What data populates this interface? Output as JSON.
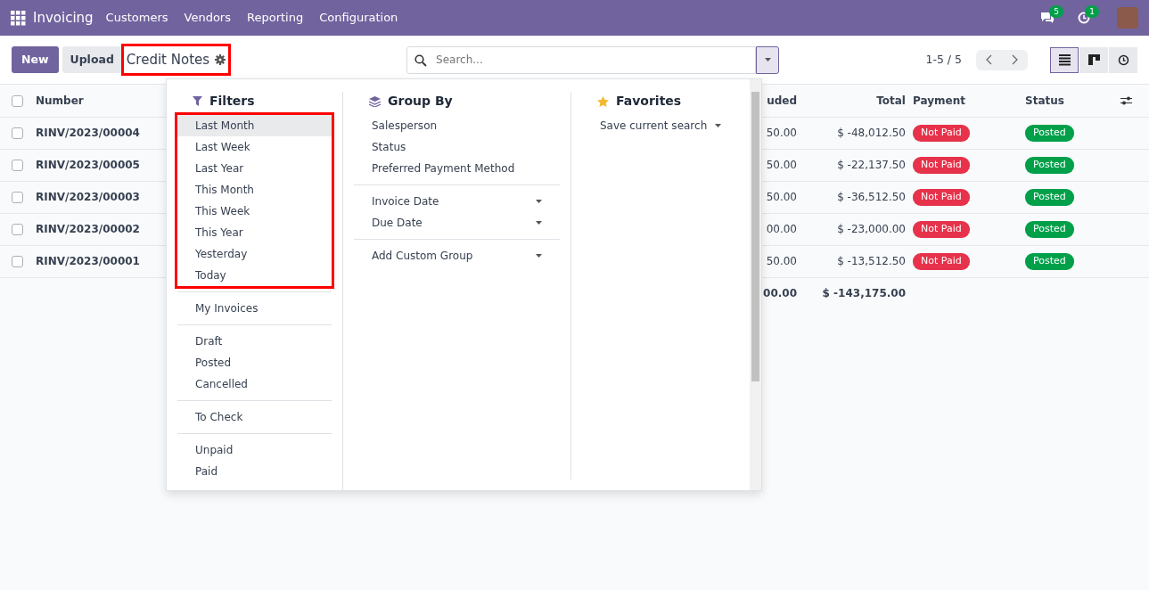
{
  "navbar": {
    "app": "Invoicing",
    "menus": [
      "Customers",
      "Vendors",
      "Reporting",
      "Configuration"
    ],
    "messages_count": "5",
    "activities_count": "1"
  },
  "control_panel": {
    "buttons": [
      "New",
      "Upload"
    ],
    "title": "Credit Notes",
    "title_annotated": true,
    "search": {
      "placeholder": "Search..."
    },
    "pager": "1-5 / 5",
    "views": [
      {
        "kind": "list",
        "selected": true
      },
      {
        "kind": "kanban",
        "selected": false
      },
      {
        "kind": "activity",
        "selected": false
      }
    ]
  },
  "table": {
    "select_all_checked": false,
    "columns": [
      "Number",
      "uded",
      "Total",
      "Payment",
      "Status"
    ],
    "rows": [
      {
        "number": "RINV/2023/00004",
        "column_2": "50.00",
        "total": "$ -48,012.50",
        "payment": "Not Paid",
        "status": "Posted",
        "checked": false
      },
      {
        "number": "RINV/2023/00005",
        "column_2": "50.00",
        "total": "$ -22,137.50",
        "payment": "Not Paid",
        "status": "Posted",
        "checked": false
      },
      {
        "number": "RINV/2023/00003",
        "column_2": "50.00",
        "total": "$ -36,512.50",
        "payment": "Not Paid",
        "status": "Posted",
        "checked": false
      },
      {
        "number": "RINV/2023/00002",
        "column_2": "00.00",
        "total": "$ -23,000.00",
        "payment": "Not Paid",
        "status": "Posted",
        "checked": false
      },
      {
        "number": "RINV/2023/00001",
        "column_2": "50.00",
        "total": "$ -13,512.50",
        "payment": "Not Paid",
        "status": "Posted",
        "checked": false
      }
    ],
    "totals": {
      "column_2": "00.00",
      "total": "$ -143,175.00"
    }
  },
  "dropdown": {
    "filters": {
      "title": "Filters",
      "groups": [
        {
          "annotated": true,
          "items": [
            {
              "label": "Last Month",
              "highlighted": true
            },
            {
              "label": "Last Week",
              "highlighted": false
            },
            {
              "label": "Last Year",
              "highlighted": false
            },
            {
              "label": "This Month",
              "highlighted": false
            },
            {
              "label": "This Week",
              "highlighted": false
            },
            {
              "label": "This Year",
              "highlighted": false
            },
            {
              "label": "Yesterday",
              "highlighted": false
            },
            {
              "label": "Today",
              "highlighted": false
            }
          ]
        },
        {
          "annotated": false,
          "items": [
            {
              "label": "My Invoices",
              "highlighted": false
            }
          ]
        },
        {
          "annotated": false,
          "items": [
            {
              "label": "Draft",
              "highlighted": false
            },
            {
              "label": "Posted",
              "highlighted": false
            },
            {
              "label": "Cancelled",
              "highlighted": false
            }
          ]
        },
        {
          "annotated": false,
          "items": [
            {
              "label": "To Check",
              "highlighted": false
            }
          ]
        },
        {
          "annotated": false,
          "items": [
            {
              "label": "Unpaid",
              "highlighted": false
            },
            {
              "label": "Paid",
              "highlighted": false
            }
          ]
        }
      ]
    },
    "group_by": {
      "title": "Group By",
      "groups": [
        [
          {
            "label": "Salesperson",
            "has_options": false
          },
          {
            "label": "Status",
            "has_options": false
          },
          {
            "label": "Preferred Payment Method",
            "has_options": false
          }
        ],
        [
          {
            "label": "Invoice Date",
            "has_options": true
          },
          {
            "label": "Due Date",
            "has_options": true
          }
        ],
        [
          {
            "label": "Add Custom Group",
            "has_options": true
          }
        ]
      ]
    },
    "favorites": {
      "title": "Favorites",
      "items": [
        {
          "label": "Save current search",
          "has_options": true
        }
      ]
    }
  }
}
